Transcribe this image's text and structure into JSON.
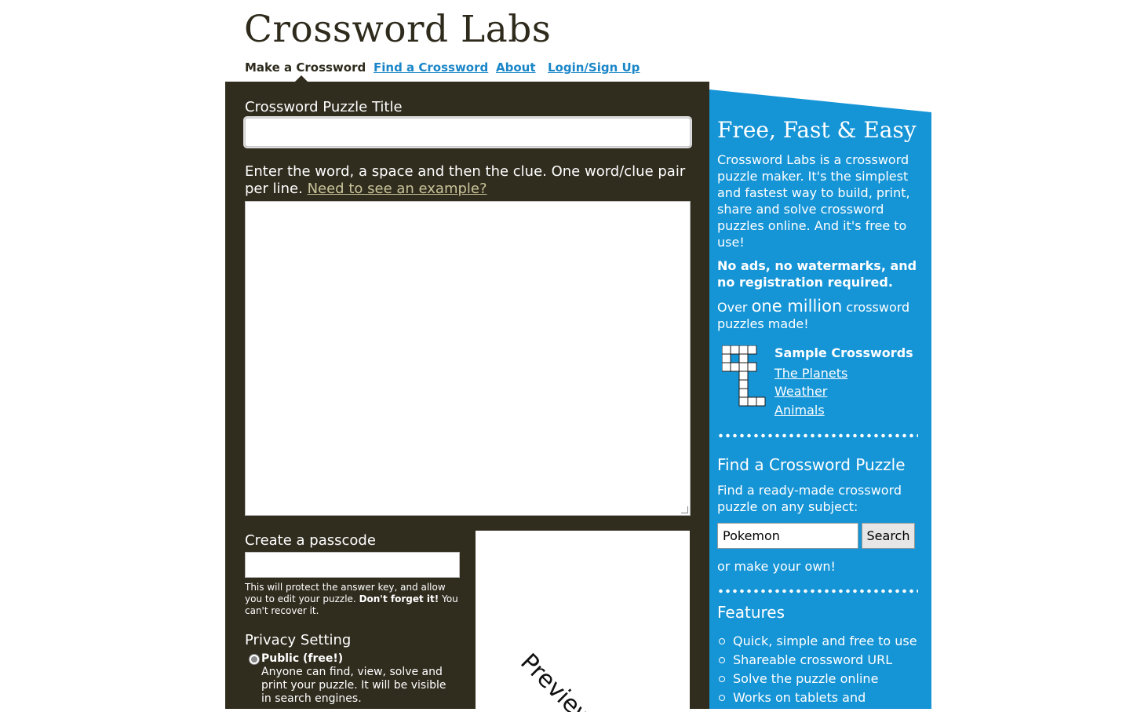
{
  "header": {
    "logo": "Crossword Labs",
    "nav": [
      {
        "label": "Make a Crossword"
      },
      {
        "label": "Find a Crossword"
      },
      {
        "label": "About"
      },
      {
        "label": "Login/Sign Up"
      }
    ]
  },
  "form": {
    "title_label": "Crossword Puzzle Title",
    "title_value": "",
    "instructions": "Enter the word, a space and then the clue. One word/clue pair per line.",
    "example_link": "Need to see an example?",
    "words_value": "",
    "passcode_label": "Create a passcode",
    "passcode_value": "",
    "passcode_note_1": "This will protect the answer key, and allow you to edit your puzzle.",
    "passcode_note_bold": "Don't forget it!",
    "passcode_note_2": "You can't recover it.",
    "privacy_label": "Privacy Setting",
    "public_title": "Public (free!)",
    "public_desc": "Anyone can find, view, solve and print your puzzle. It will be visible in search engines.",
    "preview_label": "Preview"
  },
  "sidebar": {
    "heading": "Free, Fast & Easy",
    "intro": "Crossword Labs is a crossword puzzle maker. It's the simplest and fastest way to build, print, share and solve crossword puzzles online. And it's free to use!",
    "no_ads": "No ads, no watermarks, and no registration required.",
    "over": "Over",
    "million": "one million",
    "made": "crossword puzzles made!",
    "sample_heading": "Sample Crosswords",
    "samples": [
      "The Planets",
      "Weather",
      "Animals"
    ],
    "find_heading": "Find a Crossword Puzzle",
    "find_desc": "Find a ready-made crossword puzzle on any subject:",
    "search_value": "Pokemon",
    "search_button": "Search",
    "make_own": "or make your own!",
    "features_heading": "Features",
    "features": [
      "Quick, simple and free to use",
      "Shareable crossword URL",
      "Solve the puzzle online",
      "Works on tablets and"
    ]
  },
  "colors": {
    "dark_panel": "#302c1e",
    "blue_panel": "#1594d6",
    "link": "#1a86c8"
  }
}
